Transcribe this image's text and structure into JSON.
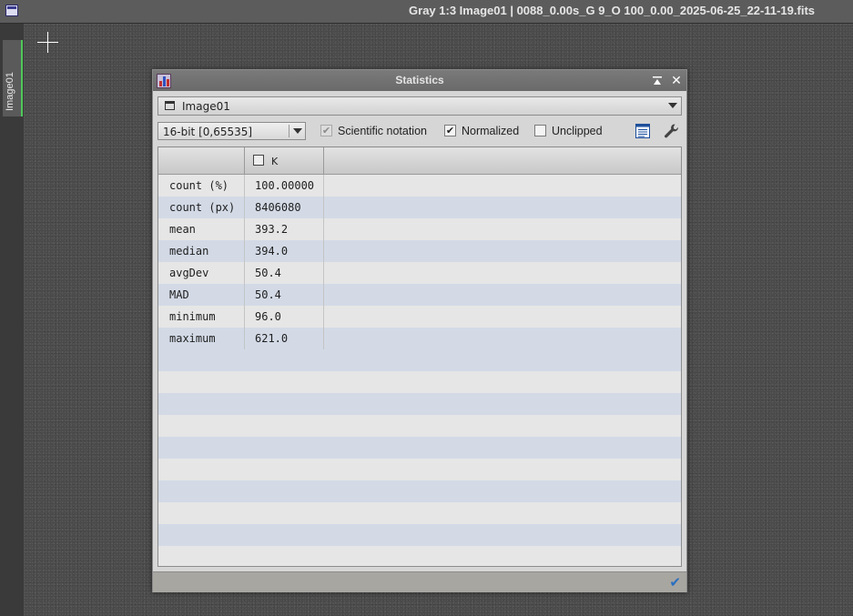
{
  "window": {
    "title": "Gray 1:3 Image01 | 0088_0.00s_G 9_O 100_0.00_2025-06-25_22-11-19.fits",
    "icon": "app-window-icon"
  },
  "tabs": [
    {
      "label": "Image01",
      "active": true,
      "accent_color": "#4fc85a"
    }
  ],
  "dialog": {
    "title": "Statistics",
    "icon": "statistics-icon",
    "view_selector": {
      "value": "Image01",
      "icon": "image-window-icon"
    },
    "options": {
      "depth": {
        "value": "16-bit [0,65535]"
      },
      "scientific_notation": {
        "label": "Scientific notation",
        "checked": true,
        "enabled": false
      },
      "normalized": {
        "label": "Normalized",
        "checked": true,
        "enabled": true
      },
      "unclipped": {
        "label": "Unclipped",
        "checked": false,
        "enabled": true
      },
      "copy_icon": "copy-to-clipboard-icon",
      "settings_icon": "wrench-icon"
    },
    "table": {
      "channel_header": "K",
      "rows": [
        {
          "name": "count (%)",
          "value": "100.00000"
        },
        {
          "name": "count (px)",
          "value": "8406080"
        },
        {
          "name": "mean",
          "value": "393.2"
        },
        {
          "name": "median",
          "value": "394.0"
        },
        {
          "name": "avgDev",
          "value": "50.4"
        },
        {
          "name": "MAD",
          "value": "50.4"
        },
        {
          "name": "minimum",
          "value": "96.0"
        },
        {
          "name": "maximum",
          "value": "621.0"
        }
      ]
    },
    "footer": {
      "ok_icon": "checkmark-icon",
      "ok_color": "#2a6fc0"
    }
  }
}
